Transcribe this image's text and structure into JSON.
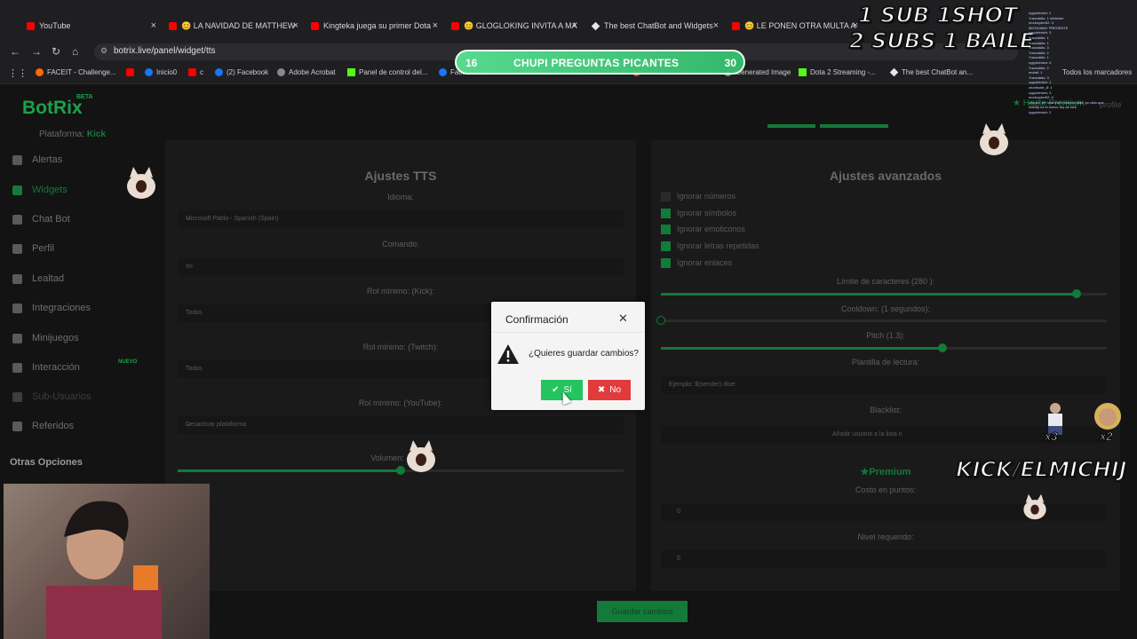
{
  "browser": {
    "tabs": [
      {
        "label": "YouTube",
        "icon": "youtube-icon"
      },
      {
        "label": "😊 LA NAVIDAD DE MATTHEW",
        "icon": "youtube-icon"
      },
      {
        "label": "Kingteka juega su primer Dota",
        "icon": "youtube-icon"
      },
      {
        "label": "😊 GLOGLOKING INVITA A MAT",
        "icon": "youtube-icon"
      },
      {
        "label": "The best ChatBot and Widgets",
        "icon": "botrix-icon"
      },
      {
        "label": "😊 LE PONEN OTRA MULTA A C",
        "icon": "youtube-icon"
      }
    ],
    "url": "botrix.live/panel/widget/tts",
    "bookmarks": [
      "FACEIT - Challenge...",
      "Inicio0",
      "c",
      "(2) Facebook",
      "Adobe Acrobat",
      "Panel de control del...",
      "Fac...",
      "Cambiar Tamaño de",
      "Generated Image",
      "Dota 2 Streaming -...",
      "The best ChatBot an...",
      "Todos los marcadores"
    ]
  },
  "app": {
    "logo": "BotRix",
    "beta": "BETA",
    "platform_label": "Plataforma:",
    "platform_value": "Kick",
    "premium_top": "Hazte Premium",
    "profile": "profile",
    "sidebar": [
      {
        "label": "Alertas",
        "icon": "warning-icon"
      },
      {
        "label": "Widgets",
        "icon": "widgets-icon",
        "active": true
      },
      {
        "label": "Chat Bot",
        "icon": "robot-icon"
      },
      {
        "label": "Perfil",
        "icon": "id-card-icon"
      },
      {
        "label": "Lealtad",
        "icon": "trophy-icon"
      },
      {
        "label": "Integraciones",
        "icon": "puzzle-icon"
      },
      {
        "label": "Minijuegos",
        "icon": "gamepad-icon"
      },
      {
        "label": "Interacción",
        "icon": "music-icon"
      },
      {
        "label": "Sub-Usuarios",
        "icon": "users-icon"
      },
      {
        "label": "Referidos",
        "icon": "user-plus-icon"
      }
    ],
    "nuevo_badge": "NUEVO",
    "otras_opciones": "Otras Opciones",
    "tts": {
      "title": "Ajustes TTS",
      "idioma_label": "Idioma:",
      "idioma_value": "Microsoft Pablo - Spanish (Spain)",
      "comando_label": "Comando:",
      "comando_value": "!m",
      "rol_kick_label": "Rol mínimo: (Kick):",
      "rol_kick_value": "Todos",
      "rol_twitch_label": "Rol mínimo: (Twitch):",
      "rol_twitch_value": "Todos",
      "rol_youtube_label": "Rol mínimo: (YouTube):",
      "rol_youtube_value": "Desactivar plataforma",
      "volumen_label": "Volumen:",
      "volumen_value": 0.5
    },
    "advanced": {
      "title": "Ajustes avanzados",
      "checks": [
        {
          "label": "Ignorar números",
          "checked": false
        },
        {
          "label": "Ignorar símbolos",
          "checked": true
        },
        {
          "label": "Ignorar emoticonos",
          "checked": true
        },
        {
          "label": "Ignorar letras repetidas",
          "checked": true
        },
        {
          "label": "Ignorar enlaces",
          "checked": true
        }
      ],
      "limite_label": "Límite de caracteres (280 ):",
      "limite_value": 280,
      "cooldown_label": "Cooldown: (1 segundos):",
      "cooldown_value": 1,
      "pitch_label": "Pitch (1.3):",
      "pitch_value": 1.3,
      "plantilla_label": "Plantilla de lectura:",
      "plantilla_placeholder": "Ejemplo: $(sender) dice:",
      "blacklist_label": "Blacklist:",
      "blacklist_placeholder": "Añadir usuario a la lista n",
      "premium_label": "Premium",
      "costo_label": "Costo en puntos:",
      "costo_value": "0",
      "nivel_label": "Nivel requerido:",
      "nivel_value": "0"
    },
    "save_button": "Guardar cambios"
  },
  "modal": {
    "title": "Confirmación",
    "question": "¿Quieres guardar cambios?",
    "yes": "Sí",
    "no": "No"
  },
  "overlay": {
    "promo_left": "16",
    "promo_text": "CHUPI PREGUNTAS PICANTES",
    "promo_right": "30",
    "subs_line1": "1 SUB  1SHOT",
    "subs_line2": "2 SUBS 1 BAILE",
    "kick": "KICK/ELMICHIJ",
    "count_a": "x3",
    "count_b": "x2",
    "chat_lines": [
      "cyppleimich: 2",
      "Yusorakiis: 1 michiwer",
      "morkoyder52: 4",
      "MICHIABAY PRESENTE",
      "cyppleimich: 3",
      "Yusorakiis: 1",
      "Yusorakiis: 1",
      "Yusorakiis: 3",
      "Yusorakiis: 2",
      "Yusorakiis: 1",
      "cyppleimich: 4",
      "Yusorakiis: 2",
      "mdrail: 1",
      "Yusorakiis: 3",
      "cyppleimich: 1",
      "zhorthotle_8: 1",
      "cyppleimich: 3",
      "morkoyder52: 0",
      "chauzz: tm hola michi buenos dias, ya visto que",
      "mandy es el nuevo rey de kick",
      "cyppleimich: 2"
    ]
  }
}
